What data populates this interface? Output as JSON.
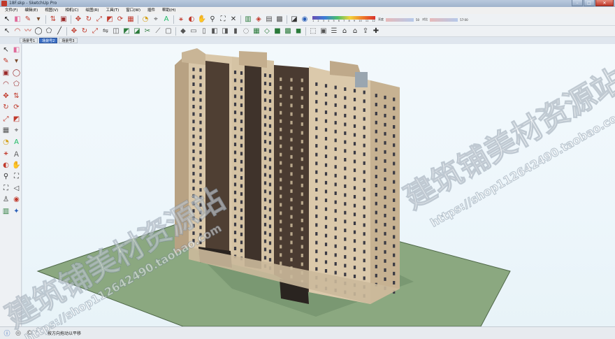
{
  "window": {
    "title": "18F.skp - SketchUp Pro",
    "controls": [
      "–",
      "□",
      "✕"
    ]
  },
  "menu": [
    "文件(F)",
    "编辑(E)",
    "视图(V)",
    "相机(C)",
    "绘图(R)",
    "工具(T)",
    "窗口(W)",
    "插件",
    "帮助(H)"
  ],
  "toolbar": {
    "row1_icons": [
      "select-icon",
      "eraser-icon",
      "pencil-icon",
      "paint-icon",
      "push-pull-icon",
      "rectangle-icon",
      "move-icon",
      "rotate-icon",
      "scale-icon",
      "offset-icon",
      "follow-me-icon",
      "tape-icon",
      "protractor-icon",
      "dimension-icon",
      "text-icon",
      "axes-icon",
      "3d-text-icon",
      "orbit-icon",
      "pan-icon",
      "zoom-icon",
      "zoom-window-icon",
      "zoom-extents-icon",
      "previous-view-icon",
      "position-camera-icon",
      "walk-icon",
      "look-around-icon",
      "section-plane-icon",
      "paint-bucket-icon",
      "shadow-icon",
      "fog-icon"
    ],
    "color_scale": [
      "1",
      "2",
      "3",
      "4",
      "5",
      "6",
      "7",
      "8",
      "9",
      "10",
      "11",
      "12"
    ],
    "slider_left": "亮度",
    "slider_left_value": "50",
    "slider_right": "对比",
    "slider_right_value": "57:00",
    "row2_icons": [
      "select-icon",
      "arc-icon",
      "freehand-icon",
      "circle-icon",
      "polygon-icon",
      "line-icon",
      "move-icon",
      "rotate-icon",
      "scale-icon",
      "flip-icon",
      "intersect-icon",
      "union-icon",
      "subtract-icon",
      "trim-icon",
      "split-icon",
      "outer-shell-icon",
      "iso-view-icon",
      "top-view-icon",
      "front-view-icon",
      "right-view-icon",
      "back-view-icon",
      "left-view-icon",
      "xray-icon",
      "wireframe-icon",
      "hidden-line-icon",
      "shaded-icon",
      "textured-icon",
      "monochrome-icon",
      "component-icon",
      "group-icon",
      "layer-icon",
      "house-icon",
      "warehouse-icon",
      "share-icon",
      "extension-icon"
    ]
  },
  "scene_tabs": [
    {
      "label": "场景号1",
      "active": false
    },
    {
      "label": "场景号2",
      "active": true
    },
    {
      "label": "场景号3",
      "active": false
    }
  ],
  "left_toolbar": [
    "select-icon",
    "eraser-icon",
    "paint-icon",
    "pencil-icon",
    "rectangle-icon",
    "circle-icon",
    "arc-icon",
    "polygon-icon",
    "move-icon",
    "push-pull-icon",
    "rotate-icon",
    "follow-me-icon",
    "scale-icon",
    "offset-icon",
    "tape-icon",
    "dimension-icon",
    "protractor-icon",
    "text-icon",
    "axes-icon",
    "3d-text-icon",
    "orbit-icon",
    "pan-icon",
    "zoom-icon",
    "zoom-window-icon",
    "zoom-extents-icon",
    "previous-icon",
    "walk-icon",
    "look-around-icon",
    "section-icon",
    "position-camera-icon"
  ],
  "status": {
    "hint": "按方向拖动以平移"
  },
  "watermark": {
    "text_cn": "建筑铺美材资源站",
    "url": "https://shop112642490.taobao.com"
  },
  "colors": {
    "building_light": "#d8c6a8",
    "building_dark": "#4a3a30",
    "ground": "#8aa880",
    "sky": "#eef7fb"
  }
}
